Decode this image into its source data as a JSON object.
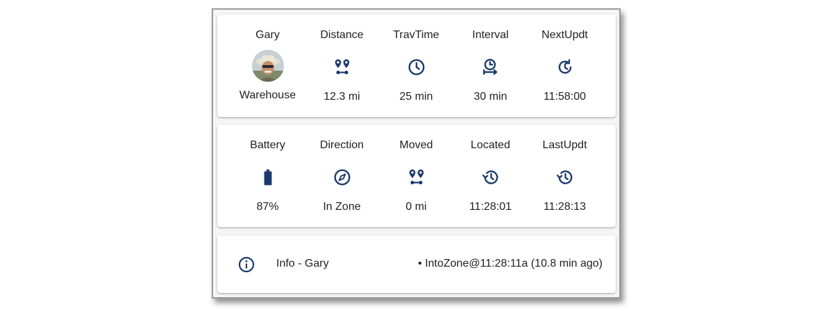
{
  "accent_color": "#1b3a6b",
  "card_top": {
    "cells": [
      {
        "label": "Gary",
        "value": "Warehouse",
        "icon": "avatar-photo"
      },
      {
        "label": "Distance",
        "value": "12.3 mi",
        "icon": "map-marker-distance-icon"
      },
      {
        "label": "TravTime",
        "value": "25 min",
        "icon": "clock-outline-icon"
      },
      {
        "label": "Interval",
        "value": "30 min",
        "icon": "timer-arrow-right-icon"
      },
      {
        "label": "NextUpdt",
        "value": "11:58:00",
        "icon": "clock-refresh-icon"
      }
    ]
  },
  "card_mid": {
    "cells": [
      {
        "label": "Battery",
        "value": "87%",
        "icon": "battery-icon"
      },
      {
        "label": "Direction",
        "value": "In Zone",
        "icon": "compass-icon"
      },
      {
        "label": "Moved",
        "value": "0 mi",
        "icon": "map-marker-distance-icon"
      },
      {
        "label": "Located",
        "value": "11:28:01",
        "icon": "history-icon"
      },
      {
        "label": "LastUpdt",
        "value": "11:28:13",
        "icon": "history-icon"
      }
    ]
  },
  "info": {
    "title": "Info - Gary",
    "message": "• IntoZone@11:28:11a (10.8 min ago)",
    "icon": "information-outline-icon"
  }
}
